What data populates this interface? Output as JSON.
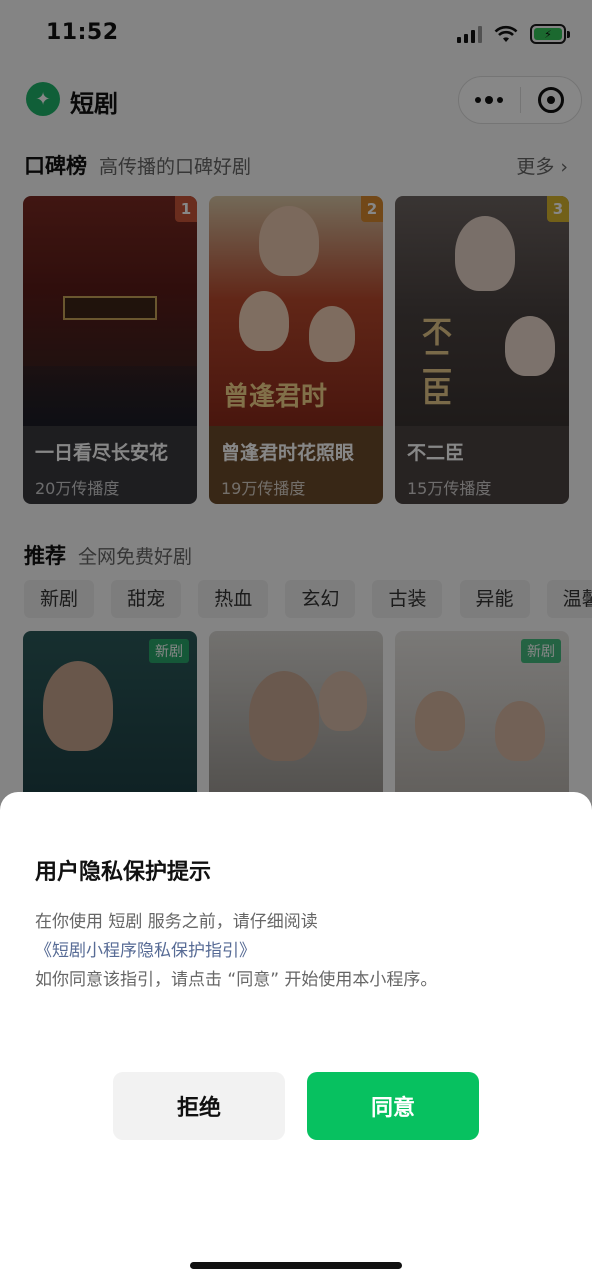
{
  "status": {
    "time": "11:52"
  },
  "header": {
    "title": "短剧"
  },
  "ranking": {
    "title": "口碑榜",
    "subtitle": "高传播的口碑好剧",
    "more": "更多 ›",
    "items": [
      {
        "rank": "1",
        "name": "一日看尽长安花",
        "plays": "20万传播度",
        "rank_color": "#c8553a"
      },
      {
        "rank": "2",
        "name": "曾逢君时花照眼",
        "plays": "19万传播度",
        "rank_color": "#d8892f"
      },
      {
        "rank": "3",
        "name": "不二臣",
        "plays": "15万传播度",
        "rank_color": "#d8b52f"
      }
    ]
  },
  "recommend": {
    "title": "推荐",
    "subtitle": "全网免费好剧",
    "tags": [
      "新剧",
      "甜宠",
      "热血",
      "玄幻",
      "古装",
      "异能",
      "温馨"
    ],
    "badge": "新剧"
  },
  "dialog": {
    "title": "用户隐私保护提示",
    "line1": "在你使用 短剧 服务之前，请仔细阅读",
    "link": "《短剧小程序隐私保护指引》",
    "line2": "如你同意该指引，请点击 “同意” 开始使用本小程序。",
    "reject": "拒绝",
    "agree": "同意"
  },
  "colors": {
    "accent": "#07c160",
    "link": "#576b95"
  }
}
